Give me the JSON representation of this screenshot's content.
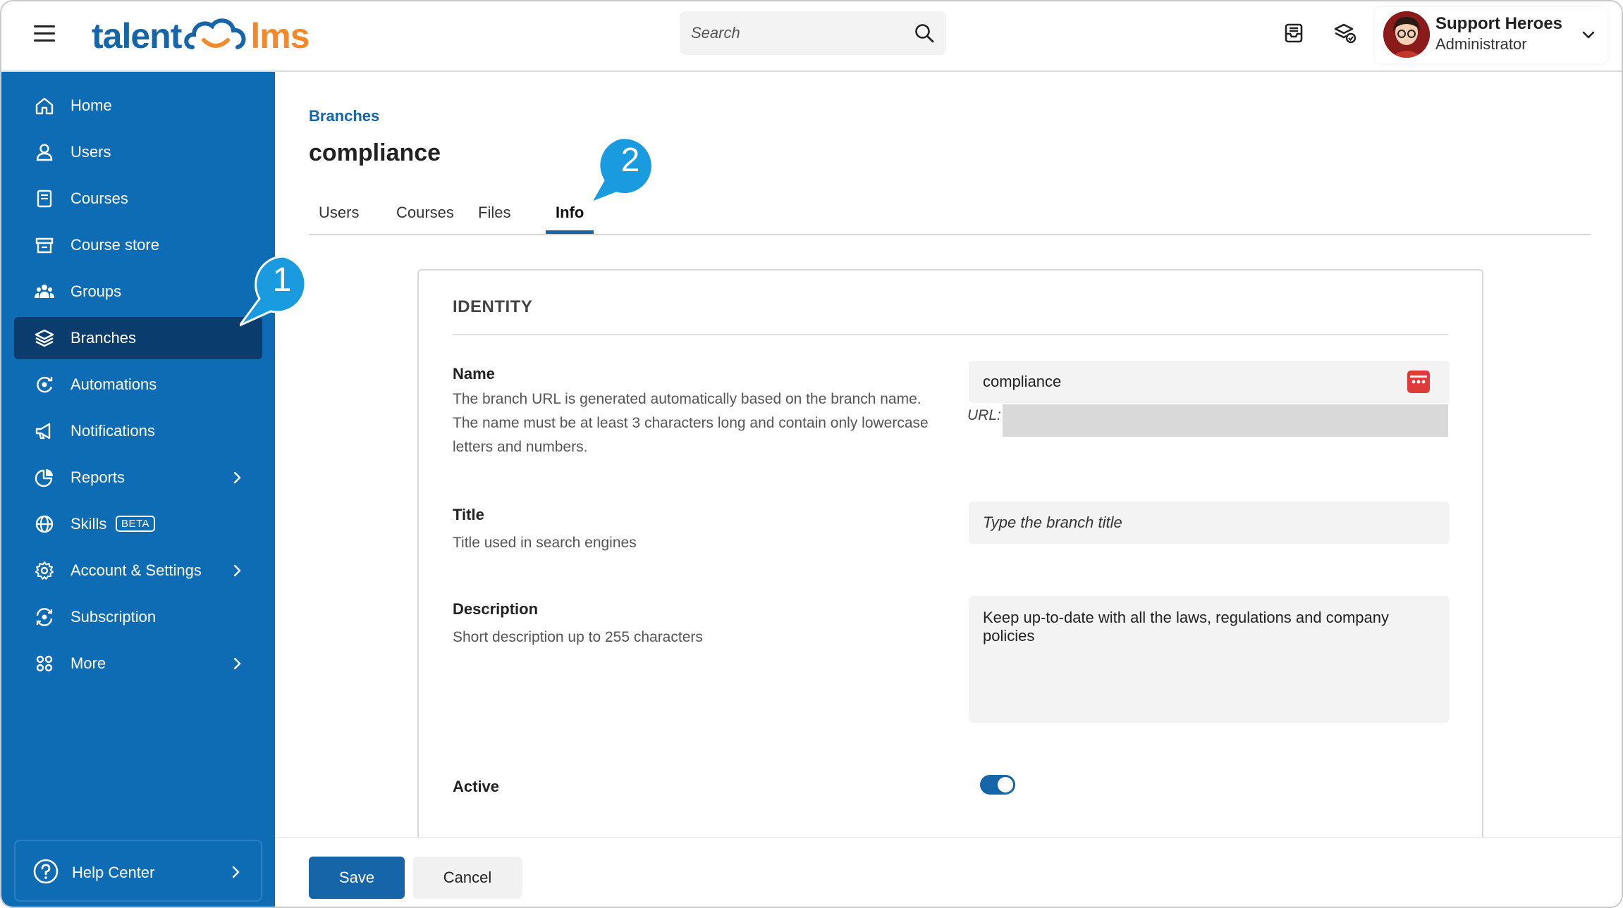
{
  "header": {
    "logo_left": "talent",
    "logo_right": "lms",
    "search_placeholder": "Search",
    "user_name": "Support Heroes",
    "user_role": "Administrator"
  },
  "sidebar": {
    "items": [
      {
        "label": "Home",
        "icon": "home-icon"
      },
      {
        "label": "Users",
        "icon": "user-icon"
      },
      {
        "label": "Courses",
        "icon": "book-icon"
      },
      {
        "label": "Course store",
        "icon": "store-icon"
      },
      {
        "label": "Groups",
        "icon": "groups-icon"
      },
      {
        "label": "Branches",
        "icon": "layers-icon",
        "active": true
      },
      {
        "label": "Automations",
        "icon": "automation-icon"
      },
      {
        "label": "Notifications",
        "icon": "megaphone-icon"
      },
      {
        "label": "Reports",
        "icon": "pie-chart-icon",
        "has_submenu": true
      },
      {
        "label": "Skills",
        "icon": "globe-icon",
        "badge": "BETA"
      },
      {
        "label": "Account & Settings",
        "icon": "gear-icon",
        "has_submenu": true
      },
      {
        "label": "Subscription",
        "icon": "subscription-icon"
      },
      {
        "label": "More",
        "icon": "grid-icon",
        "has_submenu": true
      }
    ],
    "help_label": "Help Center"
  },
  "main": {
    "breadcrumb": "Branches",
    "title": "compliance",
    "tabs": [
      "Users",
      "Courses",
      "Files",
      "Info"
    ],
    "active_tab": "Info",
    "callouts": [
      "1",
      "2"
    ]
  },
  "form": {
    "section_title": "IDENTITY",
    "name": {
      "label": "Name",
      "help": "The branch URL is generated automatically based on the branch name. The name must be at least 3 characters long and contain only lowercase letters and numbers.",
      "value": "compliance",
      "url_label": "URL:"
    },
    "title": {
      "label": "Title",
      "help": "Title used in search engines",
      "placeholder": "Type the branch title"
    },
    "description": {
      "label": "Description",
      "help": "Short description up to 255 characters",
      "value": "Keep up-to-date with all the laws, regulations and company policies"
    },
    "active": {
      "label": "Active",
      "on": true
    }
  },
  "footer": {
    "save_label": "Save",
    "cancel_label": "Cancel"
  },
  "colors": {
    "primary": "#1565a8",
    "sidebar": "#0e6cb5",
    "sidebar_active": "#0a3d6e",
    "callout": "#1a9be0",
    "logo_orange": "#f28a2b"
  }
}
